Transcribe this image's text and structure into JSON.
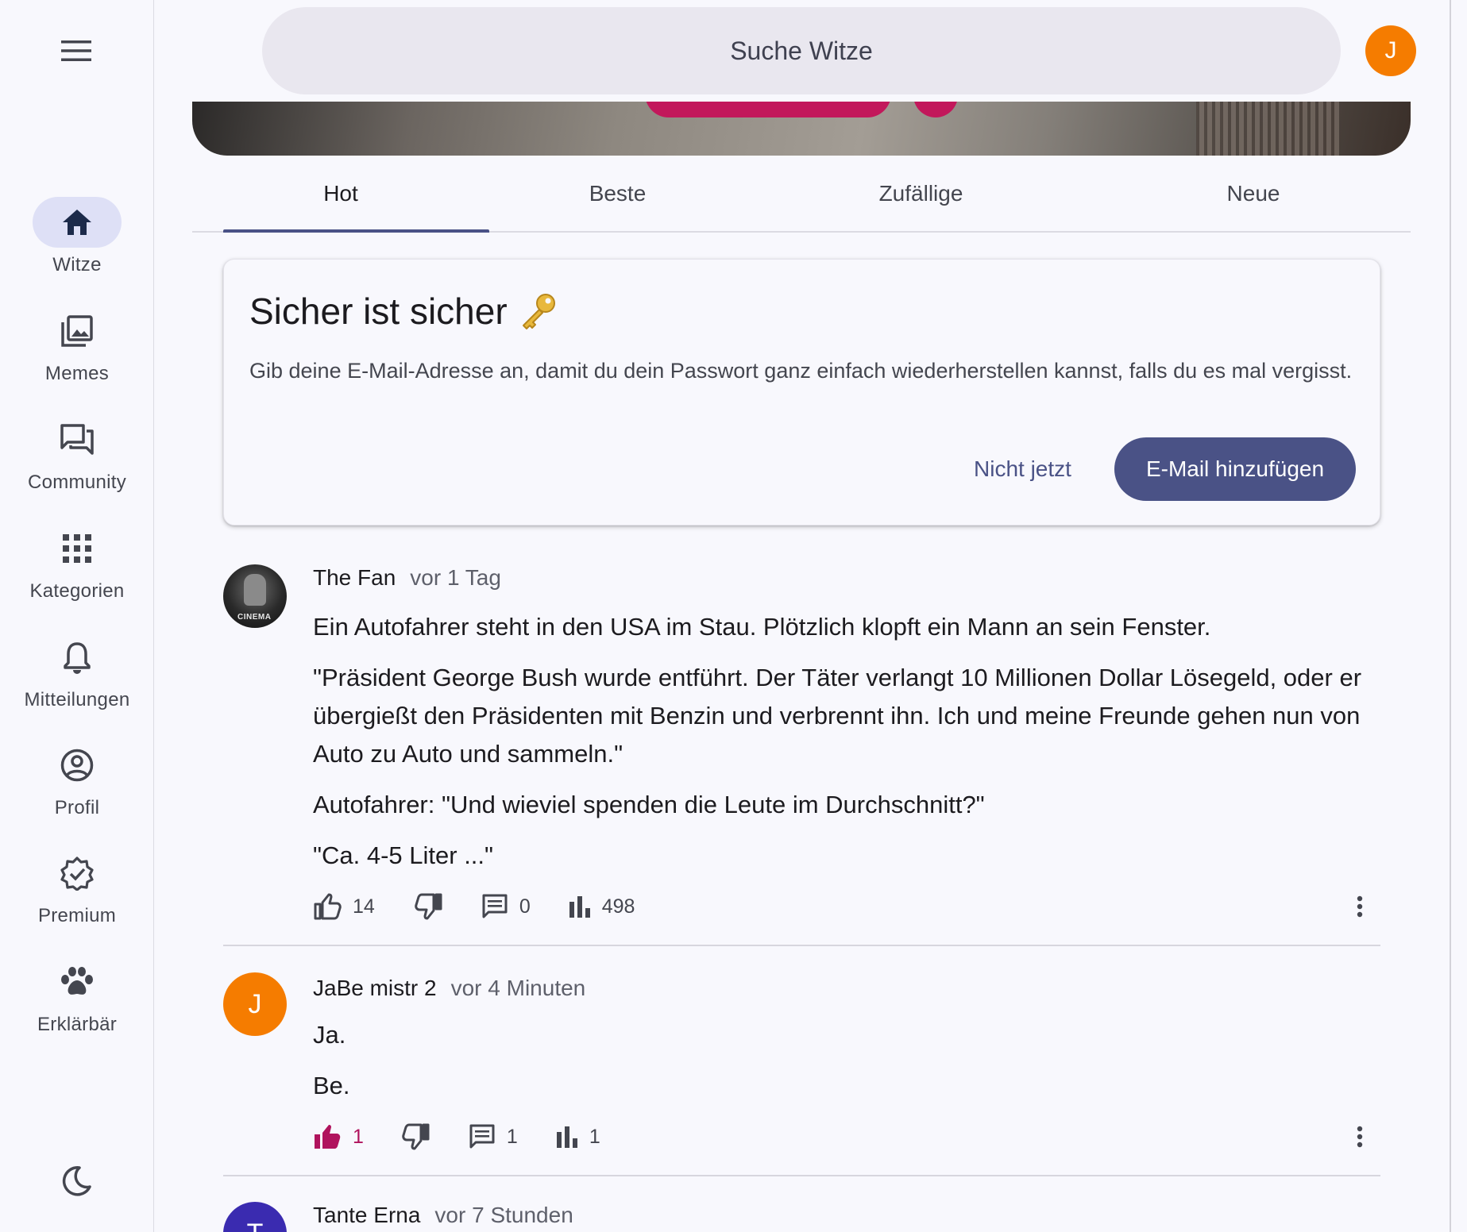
{
  "search": {
    "placeholder": "Suche Witze"
  },
  "user": {
    "initial": "J"
  },
  "sidebar": {
    "items": [
      {
        "label": "Witze",
        "icon": "home-icon",
        "active": true
      },
      {
        "label": "Memes",
        "icon": "image-gallery-icon"
      },
      {
        "label": "Community",
        "icon": "forum-icon"
      },
      {
        "label": "Kategorien",
        "icon": "apps-grid-icon"
      },
      {
        "label": "Mitteilungen",
        "icon": "bell-icon"
      },
      {
        "label": "Profil",
        "icon": "account-circle-icon"
      },
      {
        "label": "Premium",
        "icon": "verified-badge-icon"
      },
      {
        "label": "Erklärbär",
        "icon": "paw-icon"
      }
    ]
  },
  "tabs": [
    {
      "label": "Hot",
      "active": true
    },
    {
      "label": "Beste"
    },
    {
      "label": "Zufällige"
    },
    {
      "label": "Neue"
    }
  ],
  "email_card": {
    "title": "Sicher ist sicher",
    "title_icon": "key-icon",
    "text": "Gib deine E-Mail-Adresse an, damit du dein Passwort ganz einfach wiederherstellen kannst, falls du es mal vergisst.",
    "dismiss_label": "Nicht jetzt",
    "confirm_label": "E-Mail hinzufügen"
  },
  "posts": [
    {
      "author": "The Fan",
      "time": "vor 1 Tag",
      "avatar_text": "CINEMA",
      "paragraphs": [
        "Ein Autofahrer steht in den USA im Stau. Plötzlich klopft ein Mann an sein Fenster.",
        "\"Präsident George Bush wurde entführt. Der Täter verlangt 10 Millionen Dollar Lösegeld, oder er übergießt den Präsidenten mit Benzin und verbrennt ihn. Ich und meine Freunde gehen nun von Auto zu Auto und sammeln.\"",
        "Autofahrer: \"Und wieviel spenden die Leute im Durchschnitt?\"",
        "\"Ca. 4-5 Liter ...\""
      ],
      "likes": "14",
      "comments": "0",
      "views": "498",
      "liked": false
    },
    {
      "author": "JaBe mistr 2",
      "time": "vor 4 Minuten",
      "avatar_initial": "J",
      "paragraphs": [
        "Ja.",
        "Be."
      ],
      "likes": "1",
      "comments": "1",
      "views": "1",
      "liked": true
    },
    {
      "author": "Tante Erna",
      "time": "vor 7 Stunden",
      "avatar_initial": "T"
    }
  ],
  "colors": {
    "primary": "#4a5286",
    "accent_like": "#b0135d",
    "avatar_orange": "#f57c00",
    "avatar_purple": "#3a2bb0",
    "nav_active_bg": "#dee0f6"
  }
}
